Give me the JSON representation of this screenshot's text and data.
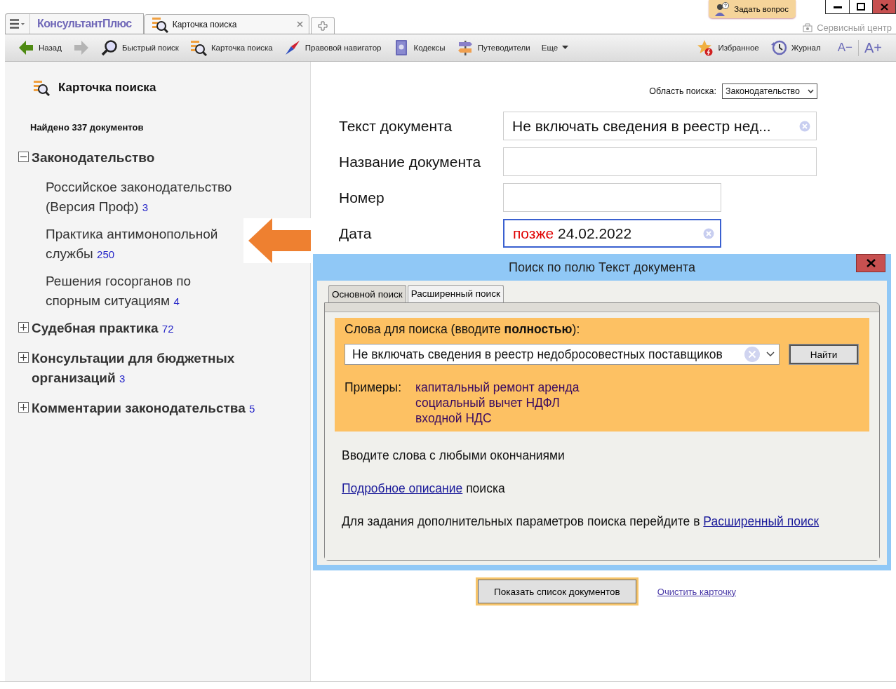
{
  "header": {
    "logo": "КонсультантПлюс",
    "tabs": [
      {
        "label": "Карточка поиска",
        "selected": true
      }
    ],
    "ask_button": "Задать вопрос",
    "service_link": "Сервисный центр"
  },
  "toolbar": {
    "left": [
      {
        "kind": "back",
        "label": "Назад"
      },
      {
        "kind": "forward"
      },
      {
        "kind": "quick-search",
        "label": "Быстрый поиск"
      },
      {
        "kind": "search-card",
        "label": "Карточка поиска"
      },
      {
        "kind": "navigator",
        "label": "Правовой навигатор"
      },
      {
        "kind": "codex",
        "label": "Кодексы"
      },
      {
        "kind": "guides",
        "label": "Путеводители"
      },
      {
        "kind": "more",
        "label": "Еще"
      }
    ],
    "right": [
      {
        "kind": "favorites",
        "label": "Избранное"
      },
      {
        "kind": "journal",
        "label": "Журнал"
      },
      {
        "kind": "font",
        "label": "A−"
      },
      {
        "kind": "font",
        "label": "A+"
      }
    ]
  },
  "sidebar": {
    "title": "Карточка поиска",
    "found": "Найдено 337 документов",
    "tree": [
      {
        "label": "Законодательство",
        "expanded": true,
        "children": [
          {
            "label": "Российское законодательство (Версия Проф)",
            "count": "3"
          },
          {
            "label": "Практика антимонопольной службы",
            "count": "250"
          },
          {
            "label": "Решения госорганов по спорным ситуациям",
            "count": "4"
          }
        ]
      },
      {
        "label": "Судебная практика",
        "count": "72",
        "expanded": false
      },
      {
        "label": "Консультации для бюджетных организаций",
        "count": "3",
        "expanded": false
      },
      {
        "label": "Комментарии законодательства",
        "count": "5",
        "expanded": false
      }
    ]
  },
  "form": {
    "scope_label": "Область поиска:",
    "scope_value": "Законодательство",
    "fields": [
      {
        "kind": "text",
        "label": "Текст документа",
        "value": "Не включать сведения в реестр нед...",
        "clear_button": true,
        "focused": false
      },
      {
        "kind": "text",
        "label": "Название документа",
        "clear_button": false,
        "focused": false
      },
      {
        "kind": "number",
        "label": "Номер",
        "clear_button": false,
        "focused": false
      },
      {
        "kind": "date",
        "label": "Дата",
        "qualifier": "позже",
        "value": "24.02.2022",
        "clear_button": true,
        "focused": true
      }
    ]
  },
  "dialog": {
    "title": "Поиск по полю Текст документа",
    "tabs": [
      {
        "label": "Основной поиск",
        "selected": true
      },
      {
        "label": "Расширенный поиск",
        "selected": false
      }
    ],
    "prompt": "Слова для поиска (вводите **полностью**):",
    "query": "Не включать сведения в реестр недобросовестных поставщиков",
    "find_button": "Найти",
    "examples_label": "Примеры:",
    "examples": [
      "капитальный ремонт аренда",
      "социальный вычет НДФЛ",
      "входной НДС"
    ],
    "hint": "Вводите слова с любыми окончаниями",
    "description": {
      "link": "Подробное описание",
      "text": "поиска"
    },
    "advanced": {
      "text": "Для задания дополнительных параметров поиска перейдите в",
      "link": "Расширенный поиск"
    }
  },
  "actions": {
    "show_button": "Показать список документов",
    "clear_link": "Очистить карточку"
  }
}
